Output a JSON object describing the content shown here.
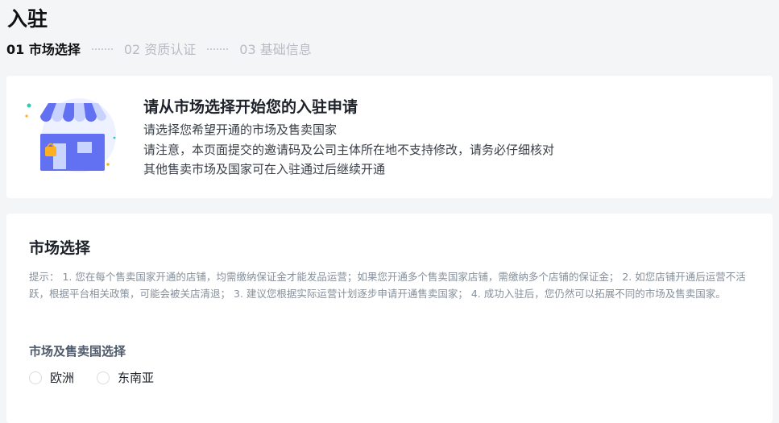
{
  "page": {
    "title": "入驻"
  },
  "steps": [
    {
      "label": "01 市场选择",
      "active": true
    },
    {
      "label": "02 资质认证",
      "active": false
    },
    {
      "label": "03 基础信息",
      "active": false
    }
  ],
  "intro": {
    "icon": "shop-store-icon",
    "title": "请从市场选择开始您的入驻申请",
    "lines": [
      "请选择您希望开通的市场及售卖国家",
      "请注意，本页面提交的邀请码及公司主体所在地不支持修改，请务必仔细核对",
      "其他售卖市场及国家可在入驻通过后继续开通"
    ]
  },
  "market": {
    "title": "市场选择",
    "tip": "提示： 1. 您在每个售卖国家开通的店铺，均需缴纳保证金才能发品运营；如果您开通多个售卖国家店铺，需缴纳多个店铺的保证金； 2. 如您店铺开通后运营不活跃，根据平台相关政策，可能会被关店清退； 3. 建议您根据实际运营计划逐步申请开通售卖国家； 4. 成功入驻后，您仍然可以拓展不同的市场及售卖国家。",
    "field_label": "市场及售卖国选择",
    "options": [
      {
        "label": "欧洲",
        "selected": false
      },
      {
        "label": "东南亚",
        "selected": false
      }
    ]
  },
  "colors": {
    "accent": "#5b6cf0",
    "awning_blue": "#6271f2",
    "window_light": "#c9d4ff",
    "bag_orange": "#ffb020",
    "dot_teal": "#35c9b5",
    "tip_gray": "#86909c"
  }
}
